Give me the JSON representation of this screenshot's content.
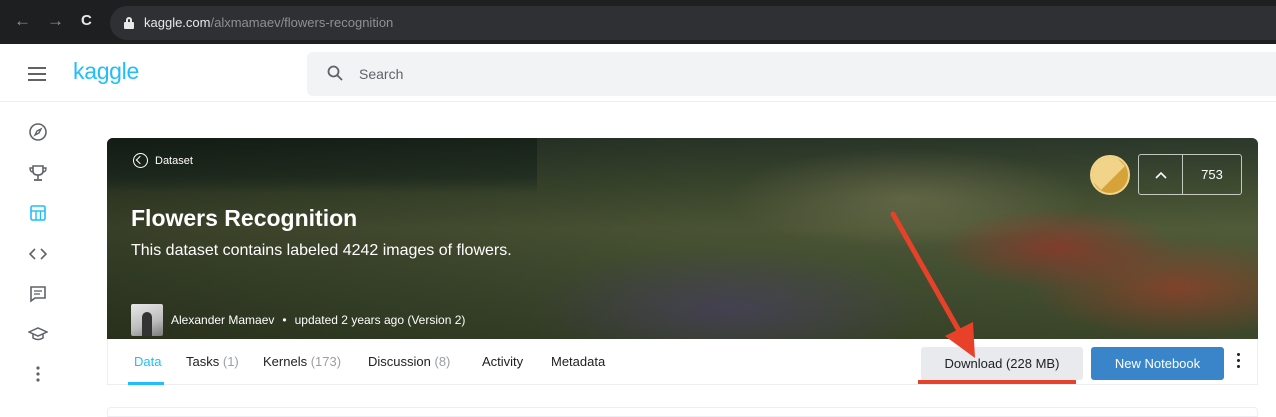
{
  "browser": {
    "back_icon": "back-arrow-icon",
    "forward_icon": "forward-arrow-icon",
    "reload_icon": "reload-icon",
    "url_host": "kaggle.com",
    "url_path": "/alxmamaev/flowers-recognition"
  },
  "header": {
    "logo": "kaggle",
    "search_placeholder": "Search"
  },
  "sidebar": {
    "icons": [
      "compass-icon",
      "trophy-icon",
      "datasets-icon",
      "code-icon",
      "discussion-icon",
      "courses-icon",
      "more-icon"
    ]
  },
  "dataset": {
    "tag": "Dataset",
    "title": "Flowers Recognition",
    "subtitle": "This dataset contains labeled 4242 images of flowers.",
    "author": "Alexander Mamaev",
    "updated": "updated 2 years ago (Version 2)",
    "vote_count": "753"
  },
  "tabs": [
    {
      "label": "Data",
      "count": ""
    },
    {
      "label": "Tasks",
      "count": "(1)"
    },
    {
      "label": "Kernels",
      "count": "(173)"
    },
    {
      "label": "Discussion",
      "count": "(8)"
    },
    {
      "label": "Activity",
      "count": ""
    },
    {
      "label": "Metadata",
      "count": ""
    }
  ],
  "actions": {
    "download": "Download (228 MB)",
    "new_notebook": "New Notebook"
  },
  "colors": {
    "accent": "#20beff",
    "primary_button": "#3a85c9",
    "annotation": "#e8412a"
  }
}
